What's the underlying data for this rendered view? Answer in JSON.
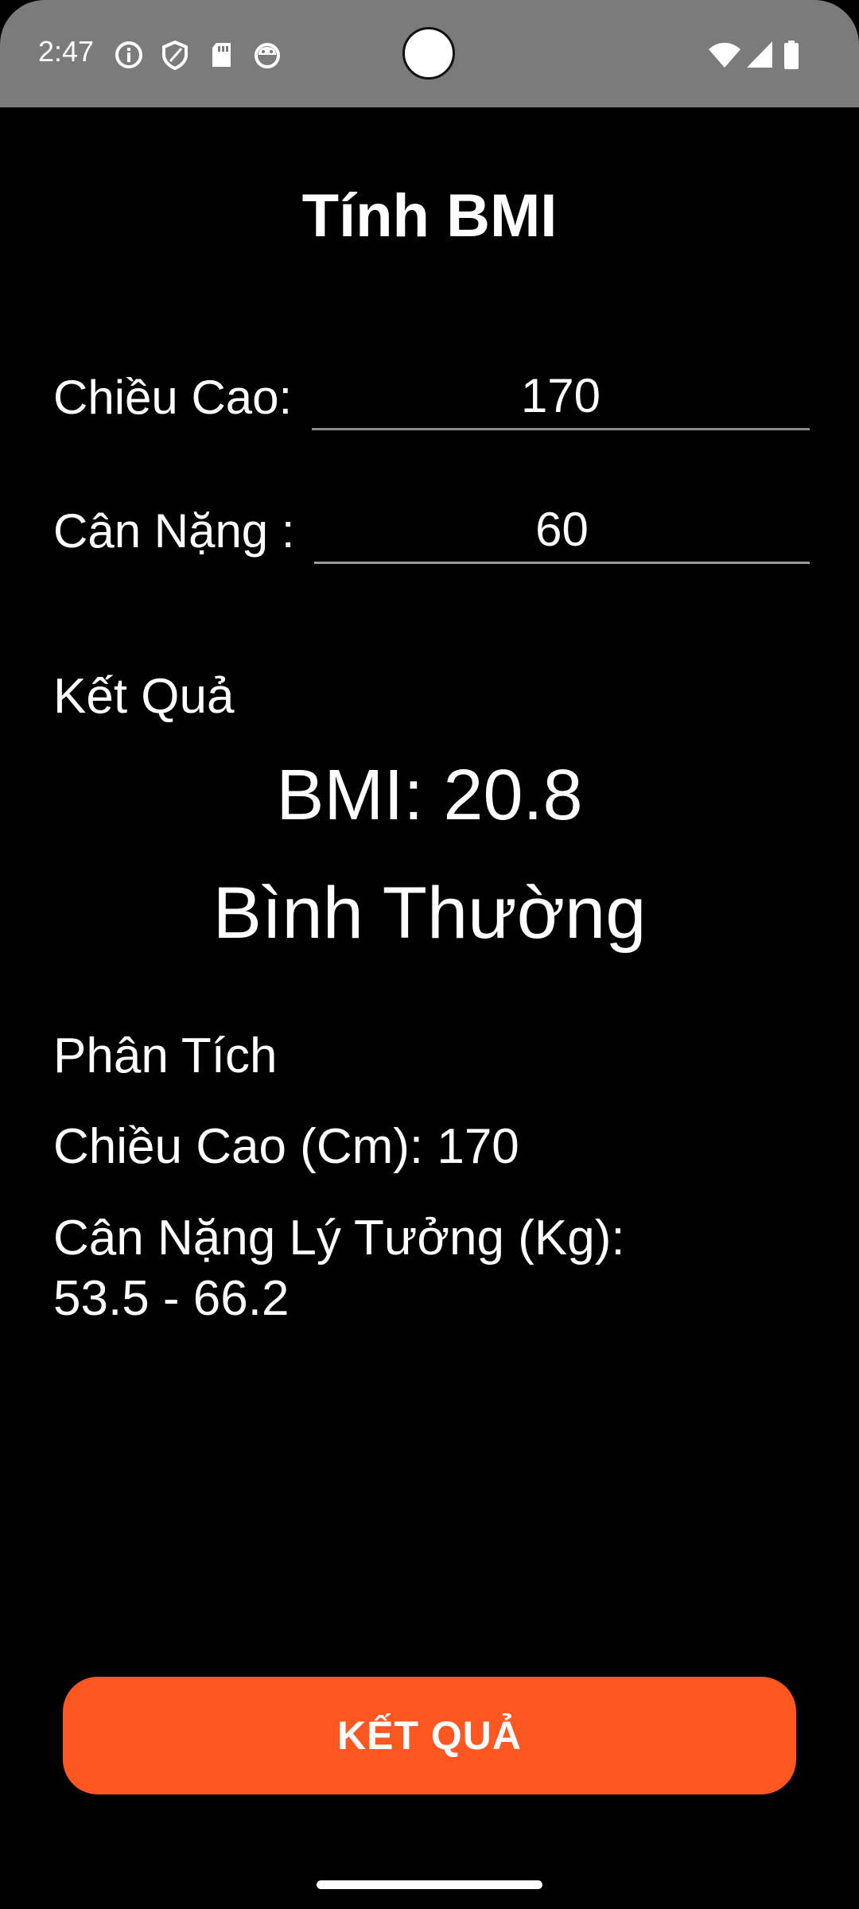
{
  "status_bar": {
    "time": "2:47",
    "left_icons": [
      "info-icon",
      "shield-icon",
      "sd-card-icon",
      "android-icon"
    ],
    "right_icons": [
      "wifi-icon",
      "signal-icon",
      "battery-icon"
    ]
  },
  "title": "Tính BMI",
  "form": {
    "height_label": "Chiều Cao:",
    "height_value": "170",
    "weight_label": "Cân Nặng :",
    "weight_value": "60"
  },
  "result": {
    "section_label": "Kết Quả",
    "bmi_text": "BMI: 20.8",
    "status_text": "Bình Thường"
  },
  "analysis": {
    "section_label": "Phân Tích",
    "height_line": "Chiều Cao (Cm): 170",
    "ideal_weight_label": "Cân Nặng Lý Tưởng (Kg):",
    "ideal_weight_range": "53.5 - 66.2"
  },
  "button": {
    "label": "KẾT QUẢ"
  },
  "colors": {
    "accent": "#ff5722",
    "background": "#000000",
    "status_bar": "#7b7b7b",
    "text": "#ffffff"
  }
}
